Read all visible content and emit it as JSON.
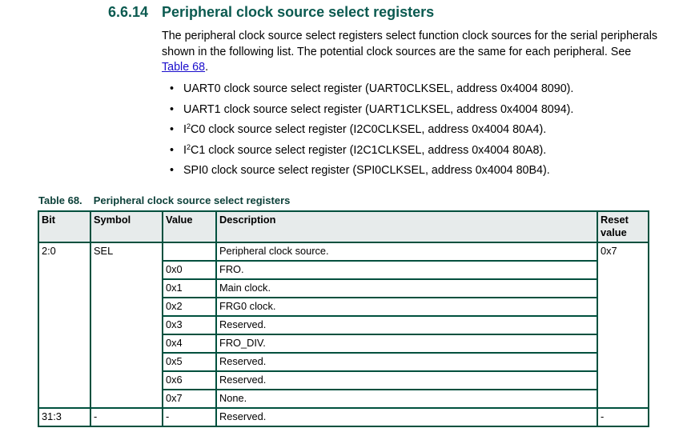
{
  "section": {
    "number": "6.6.14",
    "title": "Peripheral clock source select registers"
  },
  "intro": {
    "text": "The peripheral clock source select registers select function clock sources for the serial peripherals shown in the following list. The potential clock sources are the same for each peripheral. See ",
    "link": "Table 68",
    "end": "."
  },
  "bullets": [
    {
      "pre": "UART0 clock source select register (UART0CLKSEL, address 0x4004 8090)."
    },
    {
      "pre": "UART1 clock source select register (UART1CLKSEL, address 0x4004 8094)."
    },
    {
      "pre": "I",
      "sup": "2",
      "post": "C0 clock source select register (I2C0CLKSEL, address 0x4004 80A4)."
    },
    {
      "pre": "I",
      "sup": "2",
      "post": "C1 clock source select register (I2C1CLKSEL, address 0x4004 80A8)."
    },
    {
      "pre": "SPI0 clock source select register (SPI0CLKSEL, address 0x4004 80B4)."
    }
  ],
  "table": {
    "number": "Table 68.",
    "title": "Peripheral clock source select registers",
    "headers": [
      "Bit",
      "Symbol",
      "Value",
      "Description",
      "Reset value"
    ],
    "sel": {
      "bit": "2:0",
      "symbol": "SEL",
      "description": "Peripheral clock source.",
      "reset": "0x7",
      "values": [
        [
          "0x0",
          "FRO."
        ],
        [
          "0x1",
          "Main clock."
        ],
        [
          "0x2",
          "FRG0 clock."
        ],
        [
          "0x3",
          "Reserved."
        ],
        [
          "0x4",
          "FRO_DIV."
        ],
        [
          "0x5",
          "Reserved."
        ],
        [
          "0x6",
          "Reserved."
        ],
        [
          "0x7",
          "None."
        ]
      ]
    },
    "reserved": {
      "bit": "31:3",
      "symbol": "-",
      "value": "-",
      "description": "Reserved.",
      "reset": "-"
    }
  }
}
